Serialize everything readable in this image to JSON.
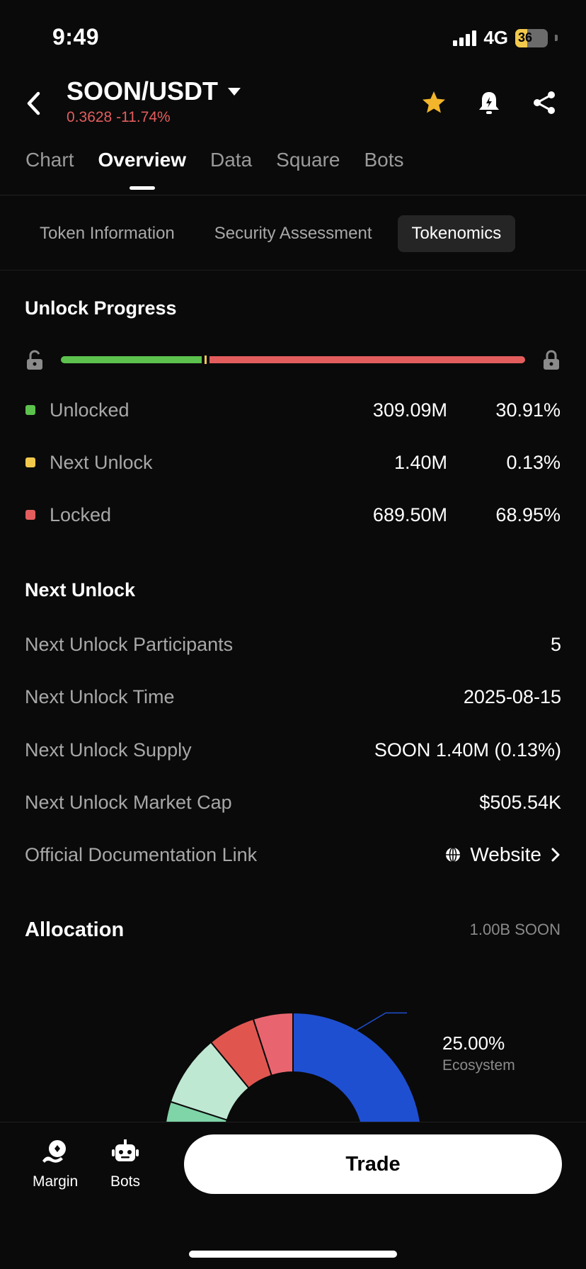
{
  "status": {
    "time": "9:49",
    "network": "4G",
    "battery": "36",
    "battery_level": 0.36
  },
  "header": {
    "pair": "SOON/USDT",
    "price_change": "0.3628 -11.74%"
  },
  "tabs": [
    {
      "label": "Chart",
      "active": false
    },
    {
      "label": "Overview",
      "active": true
    },
    {
      "label": "Data",
      "active": false
    },
    {
      "label": "Square",
      "active": false
    },
    {
      "label": "Bots",
      "active": false
    }
  ],
  "subtabs": [
    {
      "label": "Token Information",
      "active": false
    },
    {
      "label": "Security Assessment",
      "active": false
    },
    {
      "label": "Tokenomics",
      "active": true
    }
  ],
  "unlock_progress": {
    "title": "Unlock Progress",
    "unlocked_fraction": 0.3091,
    "rows": [
      {
        "label": "Unlocked",
        "amount": "309.09M",
        "percent": "30.91%",
        "color": "#5cc24d"
      },
      {
        "label": "Next Unlock",
        "amount": "1.40M",
        "percent": "0.13%",
        "color": "#f2c94c"
      },
      {
        "label": "Locked",
        "amount": "689.50M",
        "percent": "68.95%",
        "color": "#e35d5d"
      }
    ]
  },
  "next_unlock": {
    "title": "Next Unlock",
    "rows": [
      {
        "label": "Next Unlock Participants",
        "value": "5"
      },
      {
        "label": "Next Unlock Time",
        "value": "2025-08-15"
      },
      {
        "label": "Next Unlock Supply",
        "value": "SOON 1.40M (0.13%)"
      },
      {
        "label": "Next Unlock Market Cap",
        "value": "$505.54K"
      }
    ],
    "doc_link": {
      "label": "Official Documentation Link",
      "value": "Website"
    }
  },
  "allocation": {
    "title": "Allocation",
    "total": "1.00B SOON",
    "highlight": {
      "percent": "25.00%",
      "name": "Ecosystem"
    }
  },
  "chart_data": {
    "type": "pie",
    "title": "",
    "slices": [
      {
        "name": "Ecosystem",
        "value": 25.0,
        "color": "#1f4fd1"
      },
      {
        "name": "",
        "value": 5.0,
        "color": "#e8656f"
      },
      {
        "name": "",
        "value": 6.0,
        "color": "#e0564f"
      },
      {
        "name": "",
        "value": 9.0,
        "color": "#bfe8d3"
      },
      {
        "name": "",
        "value": 4.0,
        "color": "#7fd4a8"
      }
    ]
  },
  "bottom_nav": {
    "margin_label": "Margin",
    "bots_label": "Bots",
    "trade_label": "Trade"
  },
  "colors": {
    "accent_red": "#e35d5d",
    "accent_green": "#5cc24d",
    "star": "#f2b52b"
  }
}
